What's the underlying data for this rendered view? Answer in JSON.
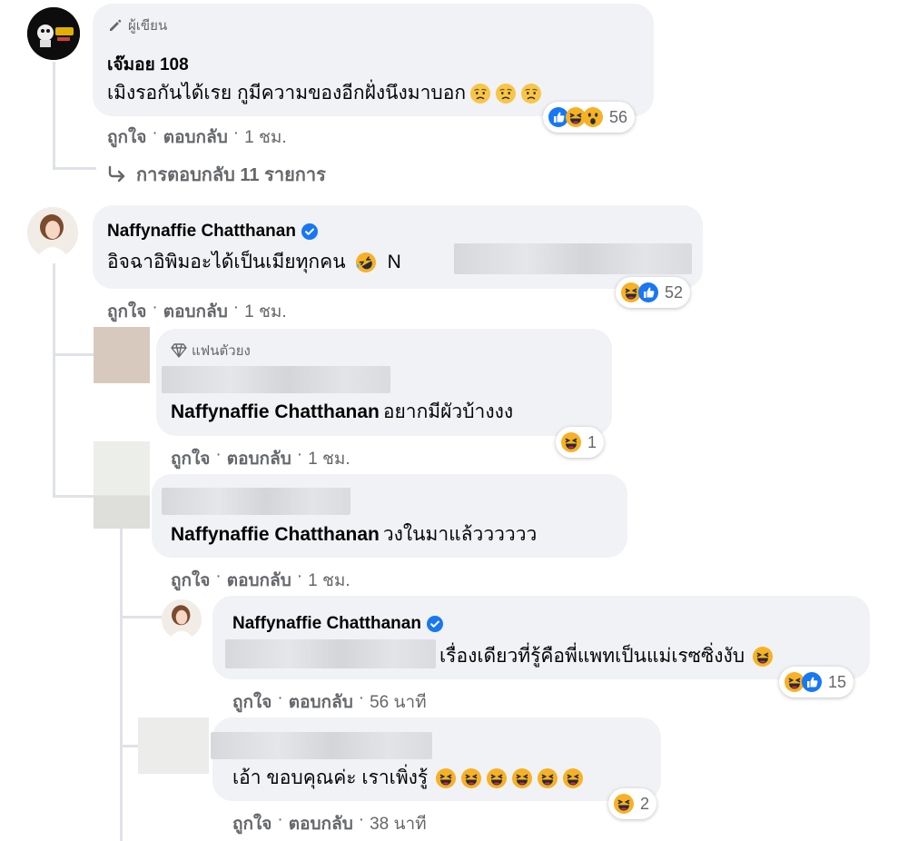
{
  "colors": {
    "bubble": "#f0f2f5",
    "secondary_text": "#65676b",
    "like_blue": "#1877f2",
    "verified_blue": "#1877f2",
    "haha_yellow": "#f7b125"
  },
  "comments": [
    {
      "badge": "ผู้เขียน",
      "badge_icon": "pencil-icon",
      "name": "เจ๊มอย 108",
      "text": "เมิงรอกันได้เรย กูมีความของอีกฝั่งนึงมาบอก",
      "reaction_count": "56",
      "like": "ถูกใจ",
      "reply": "ตอบกลับ",
      "time": "1 ชม."
    },
    {
      "name": "Naffynaffie Chatthanan",
      "text": "อิจฉาอิพิมอะได้เป็นเมียทุกคน",
      "text_tail": "N",
      "reaction_count": "52",
      "like": "ถูกใจ",
      "reply": "ตอบกลับ",
      "time": "1 ชม."
    }
  ],
  "view_replies": "การตอบกลับ 11 รายการ",
  "replies": [
    {
      "badge": "แฟนตัวยง",
      "badge_icon": "diamond-icon",
      "text": "อยากมีผัวบ้างงง",
      "tag": "Naffynaffie Chatthanan",
      "reaction_count": "1",
      "like": "ถูกใจ",
      "reply": "ตอบกลับ",
      "time": "1 ชม."
    },
    {
      "tag": "Naffynaffie Chatthanan",
      "text": "วงในมาแล้วววววว",
      "like": "ถูกใจ",
      "reply": "ตอบกลับ",
      "time": "1 ชม."
    },
    {
      "name": "Naffynaffie Chatthanan",
      "text": "เรื่องเดียวที่รู้คือพี่แพทเป็นแม่เรซซิ่งงับ",
      "reaction_count": "15",
      "like": "ถูกใจ",
      "reply": "ตอบกลับ",
      "time": "56 นาที"
    },
    {
      "text": "เอ้า ขอบคุณค่ะ เราเพิ่งรู้",
      "reaction_count": "2",
      "like": "ถูกใจ",
      "reply": "ตอบกลับ",
      "time": "38 นาที"
    }
  ],
  "separator": "·"
}
